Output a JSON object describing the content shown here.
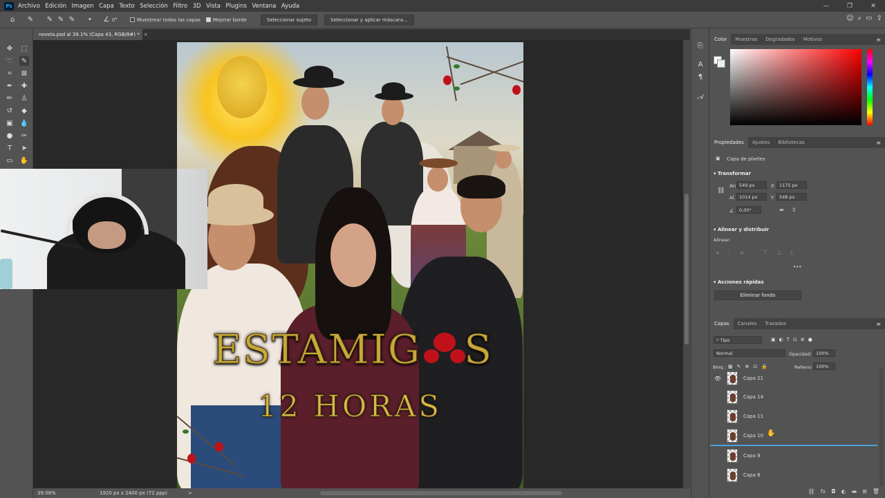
{
  "menubar": {
    "app_icon": "Ps",
    "items": [
      "Archivo",
      "Edición",
      "Imagen",
      "Capa",
      "Texto",
      "Selección",
      "Filtro",
      "3D",
      "Vista",
      "Plugins",
      "Ventana",
      "Ayuda"
    ],
    "window_controls": [
      "—",
      "❐",
      "✕"
    ]
  },
  "options_bar": {
    "angle": "0°",
    "sample_all_layers": "Muestrear todas las capas",
    "enhance_edge": "Mejorar borde",
    "select_subject": "Seleccionar sujeto",
    "select_and_mask": "Seleccionar y aplicar máscara..."
  },
  "document_tab": {
    "title": "novela.psd al 39.1% (Capa 43, RGB/8#) *",
    "close": "×"
  },
  "poster": {
    "title_left": "ESTAMIG",
    "title_right": "S",
    "subtitle": "12 HORAS"
  },
  "status": {
    "zoom": "39.08%",
    "doc_info": "1920 px x 2400 px (72 ppp)",
    "arrow": ">"
  },
  "color_panel": {
    "tabs": [
      "Color",
      "Muestras",
      "Degradados",
      "Motivos"
    ],
    "active_tab": "Color",
    "accent": "#ff0000"
  },
  "properties_panel": {
    "tabs": [
      "Propiedades",
      "Ajustes",
      "Bibliotecas"
    ],
    "active_tab": "Propiedades",
    "layer_type": "Capa de píxeles",
    "transform": {
      "title": "Transformar",
      "w_label": "An",
      "w_value": "549 px",
      "x_label": "X",
      "x_value": "1175 px",
      "h_label": "Al",
      "h_value": "1014 px",
      "y_label": "Y",
      "y_value": "548 px",
      "angle_value": "0,00°"
    },
    "align": {
      "title": "Alinear y distribuir",
      "label": "Alinear:",
      "more": "•••"
    },
    "quick_actions": {
      "title": "Acciones rápidas",
      "remove_bg": "Eliminar fondo"
    }
  },
  "layers_panel": {
    "tabs": [
      "Capas",
      "Canales",
      "Trazados"
    ],
    "active_tab": "Capas",
    "filter": "Tipo",
    "blend_mode": "Normal",
    "opacity_label": "Opacidad:",
    "opacity_value": "100%",
    "lock_label": "Bloq.:",
    "fill_label": "Relleno:",
    "fill_value": "100%",
    "layers": [
      {
        "name": "Capa 21",
        "visible": true
      },
      {
        "name": "Capa 14",
        "visible": false
      },
      {
        "name": "Capa 11",
        "visible": false
      },
      {
        "name": "Capa 10",
        "visible": false,
        "current": true
      },
      {
        "name": "Capa 9",
        "visible": false
      },
      {
        "name": "Capa 8",
        "visible": false
      }
    ],
    "footer_icons": [
      "link-icon",
      "fx-icon",
      "mask-icon",
      "adjustment-icon",
      "group-icon",
      "new-layer-icon",
      "trash-icon"
    ],
    "footer_glyphs": [
      "⛓",
      "fx",
      "◘",
      "◐",
      "▬",
      "⊞",
      "🗑"
    ]
  }
}
